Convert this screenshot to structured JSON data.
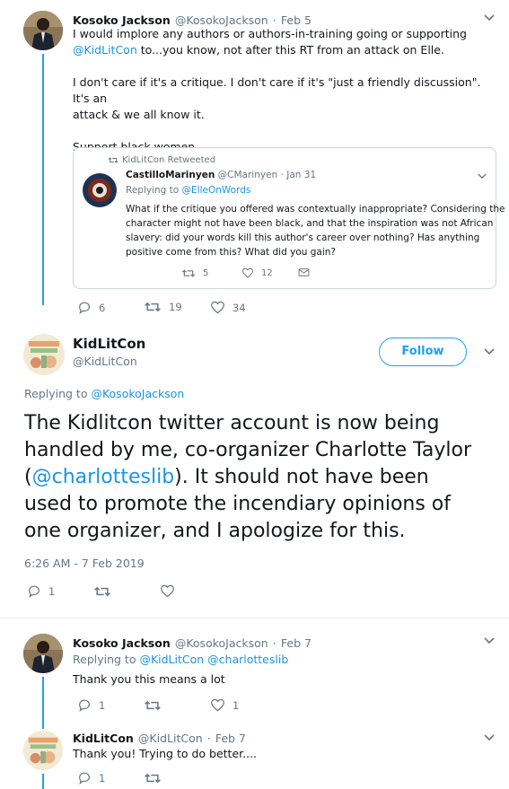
{
  "tweet1": {
    "name": "Kosoko Jackson",
    "handle": "@KosokoJackson",
    "sep": "·",
    "date": "Feb 5",
    "line1": "I would implore any authors or authors-in-training going or supporting",
    "mention": "@KidLitCon",
    "line2_rest": " to...you know, not after this RT from an attack on Elle.",
    "para2_line1": "I don't care if it's a critique. I don't care if it's \"just a friendly discussion\". It's an",
    "para2_line2": "attack & we all know it.",
    "para3": "Support black women.",
    "quote": {
      "retweet_label": "KidLitCon Retweeted",
      "name": "CastilloMarinyen",
      "handle": "@CMarinyen",
      "sep": "·",
      "date": "Jan 31",
      "replying_prefix": "Replying to ",
      "replying_to": "@ElleOnWords",
      "line1": "What if the critique you offered was contextually inappropriate? Considering the",
      "line2": "character might not have been black, and that the inspiration was not African",
      "line3": "slavery: did your words kill this author's career over nothing? Has anything",
      "line4": "positive come from this? What did you gain?",
      "retweets": "5",
      "likes": "12"
    },
    "replies": "6",
    "retweets": "19",
    "likes": "34"
  },
  "main_tweet": {
    "name": "KidLitCon",
    "handle": "@KidLitCon",
    "follow_label": "Follow",
    "replying_prefix": "Replying to ",
    "replying_to": "@KosokoJackson",
    "line1": "The Kidlitcon twitter account is now being",
    "line2": "handled by me, co-organizer Charlotte Taylor",
    "line3_open": "(",
    "line3_mention": "@charlotteslib",
    "line3_rest": ").  It should not have been",
    "line4": "used to promote the incendiary opinions of",
    "line5": "one organizer, and I apologize for this.",
    "timestamp": "6:26 AM - 7 Feb 2019",
    "replies": "1"
  },
  "reply1": {
    "name": "Kosoko Jackson",
    "handle": "@KosokoJackson",
    "sep": "·",
    "date": "Feb 7",
    "replying_prefix": "Replying to ",
    "replying_to": "@KidLitCon @charlotteslib",
    "text": "Thank you this means a lot",
    "replies": "1",
    "likes": "1"
  },
  "reply2": {
    "name": "KidLitCon",
    "handle": "@KidLitCon",
    "sep": "·",
    "date": "Feb 7",
    "text": "Thank you!  Trying to do better....",
    "replies": "1"
  },
  "colors": {
    "accent": "#1da1f2",
    "link": "#1b95e0",
    "muted": "#657786",
    "text": "#14171a",
    "border": "#e6ecf0"
  },
  "icons": [
    "chevron-down-icon",
    "reply-icon",
    "retweet-icon",
    "like-icon",
    "dm-icon"
  ]
}
